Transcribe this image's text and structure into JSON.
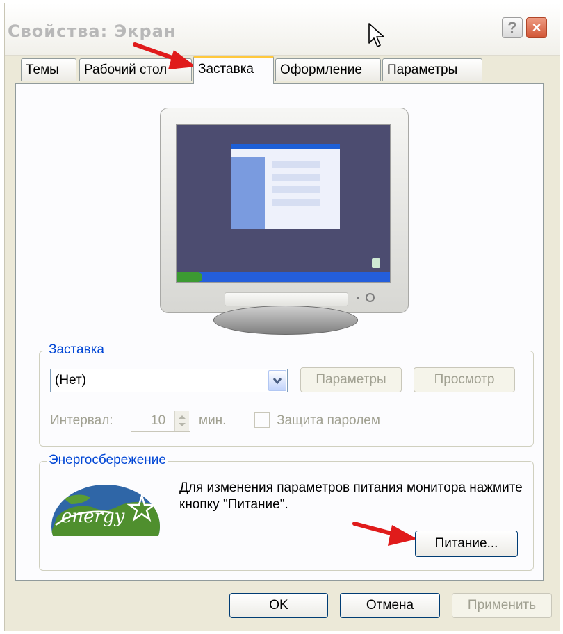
{
  "window": {
    "title": "Свойства: Экран",
    "help_label": "?",
    "close_label": "×"
  },
  "tabs": [
    {
      "label": "Темы"
    },
    {
      "label": "Рабочий стол"
    },
    {
      "label": "Заставка",
      "active": true
    },
    {
      "label": "Оформление"
    },
    {
      "label": "Параметры"
    }
  ],
  "screensaver": {
    "group_label": "Заставка",
    "selected": "(Нет)",
    "settings_label": "Параметры",
    "preview_label": "Просмотр",
    "interval_label": "Интервал:",
    "interval_value": "10",
    "interval_unit": "мин.",
    "password_label": "Защита паролем"
  },
  "energy": {
    "group_label": "Энергосбережение",
    "description": "Для изменения параметров питания монитора нажмите кнопку \"Питание\".",
    "power_button_label": "Питание...",
    "logo_text": "energy"
  },
  "footer": {
    "ok_label": "OK",
    "cancel_label": "Отмена",
    "apply_label": "Применить"
  },
  "colors": {
    "accent_blue": "#0046d5",
    "annotation_arrow": "#e01b1b",
    "active_tab_highlight": "#ffc83c"
  }
}
